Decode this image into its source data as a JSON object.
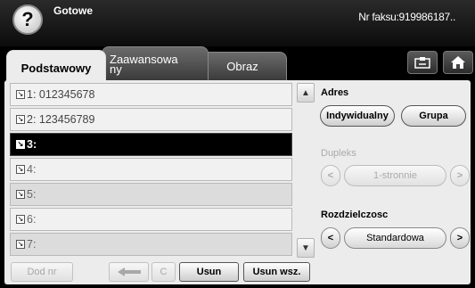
{
  "header": {
    "help_icon": "question-mark-icon",
    "status": "Gotowe",
    "fax_number": "Nr faksu:919986187.."
  },
  "tabs": [
    {
      "label": "Podstawowy",
      "active": true
    },
    {
      "label_line1": "Zaawansowa",
      "label_line2": "ny",
      "active": false
    },
    {
      "label": "Obraz",
      "active": false
    }
  ],
  "toolbar": {
    "address_book_icon": "address-book-icon",
    "home_icon": "home-icon"
  },
  "recipients": [
    {
      "label": "1: 012345678",
      "state": "filled"
    },
    {
      "label": "2: 123456789",
      "state": "filled"
    },
    {
      "label": "3:",
      "state": "selected"
    },
    {
      "label": "4:",
      "state": "empty"
    },
    {
      "label": "5:",
      "state": "empty"
    },
    {
      "label": "6:",
      "state": "empty"
    },
    {
      "label": "7:",
      "state": "empty"
    }
  ],
  "address": {
    "label": "Adres",
    "individual_label": "Indywidualny",
    "group_label": "Grupa"
  },
  "duplex": {
    "label": "Dupleks",
    "value": "1-stronnie",
    "enabled": false
  },
  "resolution": {
    "label": "Rozdzielczosc",
    "value": "Standardowa",
    "enabled": true
  },
  "bottom": {
    "add_label": "Dod nr",
    "back_icon": "backspace-arrow-icon",
    "clear_label": "C",
    "delete_label": "Usun",
    "delete_all_label": "Usun wsz."
  }
}
